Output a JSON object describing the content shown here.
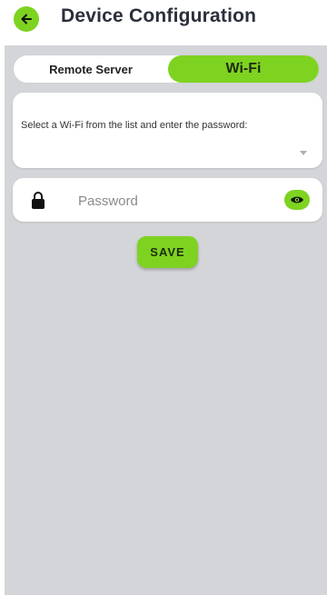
{
  "header": {
    "title": "Device Configuration",
    "back_icon": "arrow-left-icon"
  },
  "tabs": [
    {
      "label": "Remote Server",
      "selected": false
    },
    {
      "label": "Wi-Fi",
      "selected": true
    }
  ],
  "wifi": {
    "instruction": "Select a Wi-Fi from the list and enter the password:",
    "selected_network": ""
  },
  "password": {
    "placeholder": "Password",
    "value": "",
    "lock_icon": "lock-icon",
    "toggle_icon": "eye-icon"
  },
  "actions": {
    "save_label": "SAVE"
  },
  "colors": {
    "accent": "#7ed321",
    "background": "#d3d5d8",
    "card": "#ffffff"
  }
}
